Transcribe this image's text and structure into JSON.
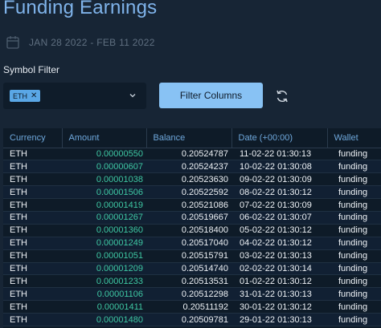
{
  "page": {
    "title": "Funding Earnings"
  },
  "date_range": {
    "text": "JAN 28 2022 - FEB 11 2022",
    "icon": "calendar-icon"
  },
  "symbol_filter": {
    "label": "Symbol Filter",
    "selected": [
      {
        "label": "ETH",
        "remove_icon": "close-icon"
      }
    ],
    "dropdown_icon": "chevron-down-icon"
  },
  "filter_button": {
    "label": "Filter Columns"
  },
  "refresh_icon": "refresh-icon",
  "colors": {
    "background": "#172535",
    "title": "#7fb3ea",
    "accent_button": "#88c2f4",
    "amount_text": "#3ec7a3",
    "header_text": "#6fa8dc"
  },
  "table": {
    "headers": [
      "Currency",
      "Amount",
      "Balance",
      "Date (+00:00)",
      "Wallet"
    ],
    "rows": [
      {
        "currency": "ETH",
        "amount": "0.00000550",
        "balance": "0.20524787",
        "date": "11-02-22 01:30:13",
        "wallet": "funding"
      },
      {
        "currency": "ETH",
        "amount": "0.00000607",
        "balance": "0.20524237",
        "date": "10-02-22 01:30:08",
        "wallet": "funding"
      },
      {
        "currency": "ETH",
        "amount": "0.00001038",
        "balance": "0.20523630",
        "date": "09-02-22 01:30:09",
        "wallet": "funding"
      },
      {
        "currency": "ETH",
        "amount": "0.00001506",
        "balance": "0.20522592",
        "date": "08-02-22 01:30:12",
        "wallet": "funding"
      },
      {
        "currency": "ETH",
        "amount": "0.00001419",
        "balance": "0.20521086",
        "date": "07-02-22 01:30:09",
        "wallet": "funding"
      },
      {
        "currency": "ETH",
        "amount": "0.00001267",
        "balance": "0.20519667",
        "date": "06-02-22 01:30:07",
        "wallet": "funding"
      },
      {
        "currency": "ETH",
        "amount": "0.00001360",
        "balance": "0.20518400",
        "date": "05-02-22 01:30:12",
        "wallet": "funding"
      },
      {
        "currency": "ETH",
        "amount": "0.00001249",
        "balance": "0.20517040",
        "date": "04-02-22 01:30:12",
        "wallet": "funding"
      },
      {
        "currency": "ETH",
        "amount": "0.00001051",
        "balance": "0.20515791",
        "date": "03-02-22 01:30:13",
        "wallet": "funding"
      },
      {
        "currency": "ETH",
        "amount": "0.00001209",
        "balance": "0.20514740",
        "date": "02-02-22 01:30:14",
        "wallet": "funding"
      },
      {
        "currency": "ETH",
        "amount": "0.00001233",
        "balance": "0.20513531",
        "date": "01-02-22 01:30:12",
        "wallet": "funding"
      },
      {
        "currency": "ETH",
        "amount": "0.00001106",
        "balance": "0.20512298",
        "date": "31-01-22 01:30:13",
        "wallet": "funding"
      },
      {
        "currency": "ETH",
        "amount": "0.00001411",
        "balance": "0.20511192",
        "date": "30-01-22 01:30:12",
        "wallet": "funding"
      },
      {
        "currency": "ETH",
        "amount": "0.00001480",
        "balance": "0.20509781",
        "date": "29-01-22 01:30:13",
        "wallet": "funding"
      }
    ]
  }
}
